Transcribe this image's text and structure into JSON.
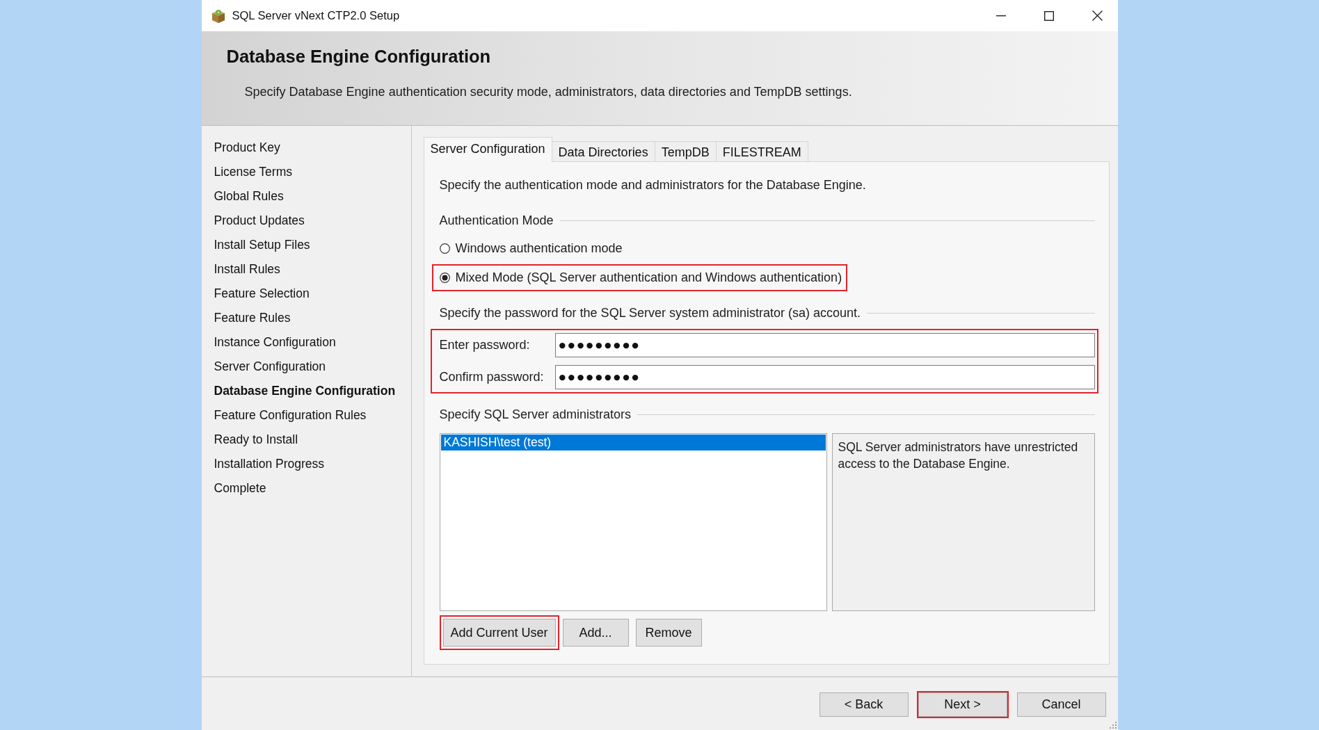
{
  "window": {
    "title": "SQL Server vNext CTP2.0 Setup"
  },
  "page_header": {
    "title": "Database Engine Configuration",
    "description": "Specify Database Engine authentication security mode, administrators, data directories and TempDB settings."
  },
  "sidebar": {
    "items": [
      {
        "label": "Product Key",
        "current": false
      },
      {
        "label": "License Terms",
        "current": false
      },
      {
        "label": "Global Rules",
        "current": false
      },
      {
        "label": "Product Updates",
        "current": false
      },
      {
        "label": "Install Setup Files",
        "current": false
      },
      {
        "label": "Install Rules",
        "current": false
      },
      {
        "label": "Feature Selection",
        "current": false
      },
      {
        "label": "Feature Rules",
        "current": false
      },
      {
        "label": "Instance Configuration",
        "current": false
      },
      {
        "label": "Server Configuration",
        "current": false
      },
      {
        "label": "Database Engine Configuration",
        "current": true
      },
      {
        "label": "Feature Configuration Rules",
        "current": false
      },
      {
        "label": "Ready to Install",
        "current": false
      },
      {
        "label": "Installation Progress",
        "current": false
      },
      {
        "label": "Complete",
        "current": false
      }
    ]
  },
  "tabs": [
    {
      "label": "Server Configuration",
      "selected": true
    },
    {
      "label": "Data Directories",
      "selected": false
    },
    {
      "label": "TempDB",
      "selected": false
    },
    {
      "label": "FILESTREAM",
      "selected": false
    }
  ],
  "server_configuration": {
    "intro": "Specify the authentication mode and administrators for the Database Engine.",
    "authentication_mode": {
      "heading": "Authentication Mode",
      "options": [
        {
          "label": "Windows authentication mode",
          "selected": false,
          "highlighted": false
        },
        {
          "label": "Mixed Mode (SQL Server authentication and Windows authentication)",
          "selected": true,
          "highlighted": true
        }
      ]
    },
    "password": {
      "heading": "Specify the password for the SQL Server system administrator (sa) account.",
      "highlighted": true,
      "fields": [
        {
          "label": "Enter password:",
          "value": "●●●●●●●●●"
        },
        {
          "label": "Confirm password:",
          "value": "●●●●●●●●●"
        }
      ]
    },
    "administrators": {
      "heading": "Specify SQL Server administrators",
      "items": [
        {
          "name": "KASHISH\\test (test)",
          "selected": true
        }
      ],
      "note": "SQL Server administrators have unrestricted access to the Database Engine.",
      "buttons": [
        {
          "label": "Add Current User",
          "highlighted": true
        },
        {
          "label": "Add...",
          "highlighted": false
        },
        {
          "label": "Remove",
          "highlighted": false
        }
      ]
    }
  },
  "footer": {
    "buttons": [
      {
        "label": "< Back",
        "highlighted": false
      },
      {
        "label": "Next >",
        "highlighted": true
      },
      {
        "label": "Cancel",
        "highlighted": false
      }
    ]
  }
}
